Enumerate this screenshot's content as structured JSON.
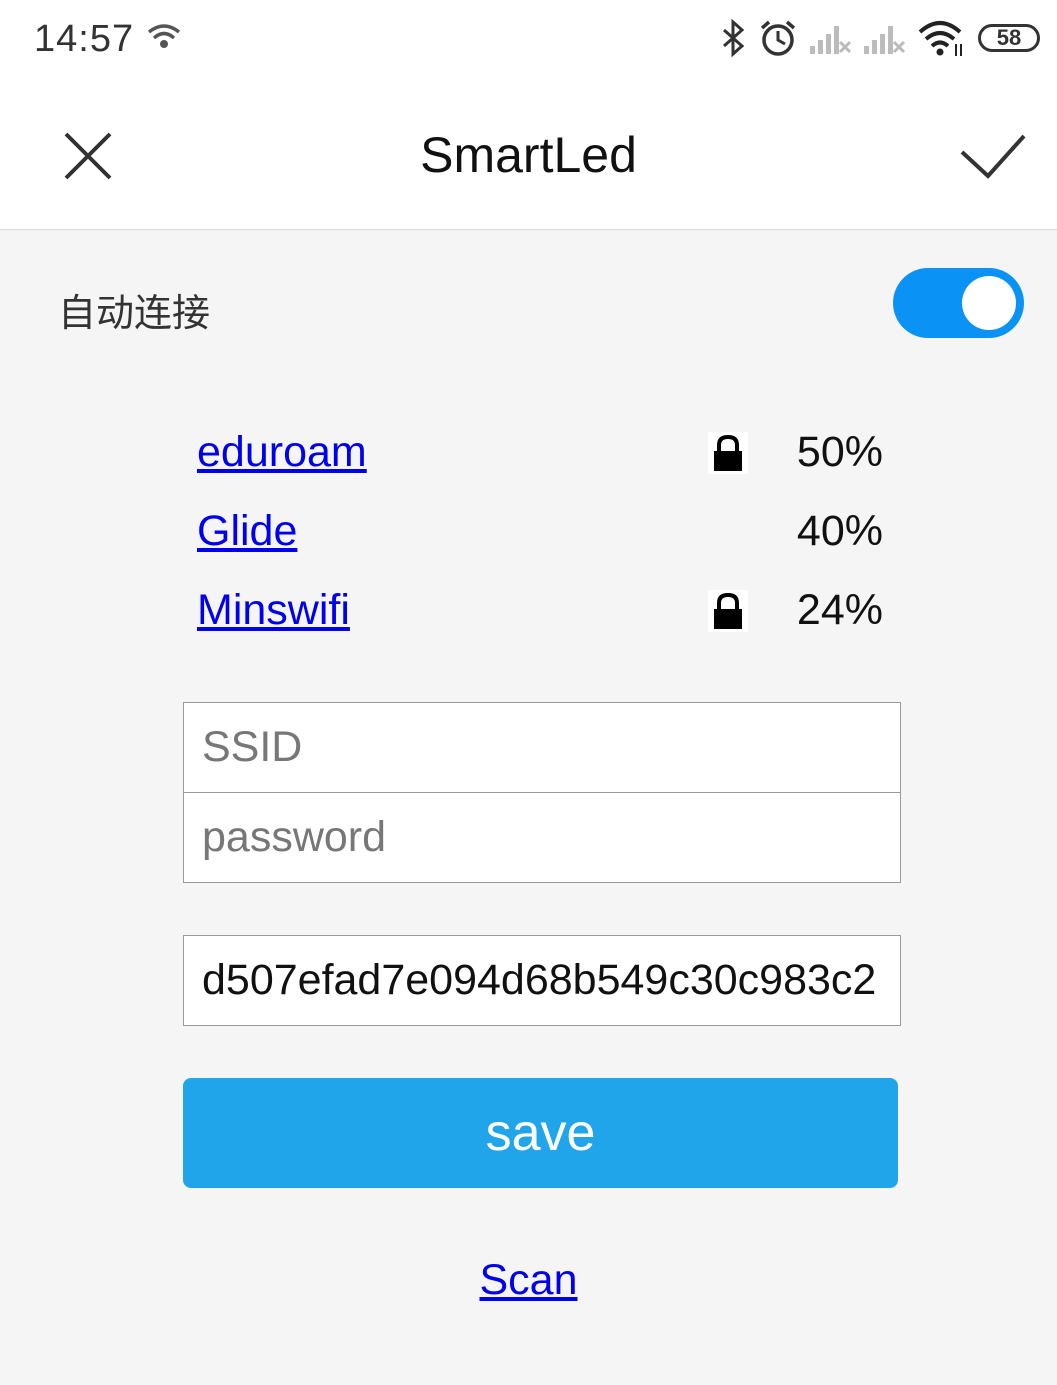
{
  "status_bar": {
    "time": "14:57",
    "battery": "58",
    "icons": [
      "hotspot-icon",
      "bluetooth-icon",
      "alarm-icon",
      "signal-icon",
      "signal-icon",
      "wifi-icon"
    ]
  },
  "header": {
    "title": "SmartLed",
    "close_icon": "close-icon",
    "confirm_icon": "check-icon"
  },
  "settings": {
    "auto_connect_label": "自动连接",
    "auto_connect_on": true,
    "toggle_color": "#0a93f5"
  },
  "networks": [
    {
      "ssid": "eduroam",
      "locked": true,
      "signal": "50%"
    },
    {
      "ssid": "Glide",
      "locked": false,
      "signal": "40%"
    },
    {
      "ssid": "Minswifi",
      "locked": true,
      "signal": "24%"
    }
  ],
  "form": {
    "ssid_placeholder": "SSID",
    "password_placeholder": "password",
    "token_value": "d507efad7e094d68b549c30c983c2"
  },
  "actions": {
    "save_label": "save",
    "scan_label": "Scan",
    "save_color": "#21a5ea"
  }
}
